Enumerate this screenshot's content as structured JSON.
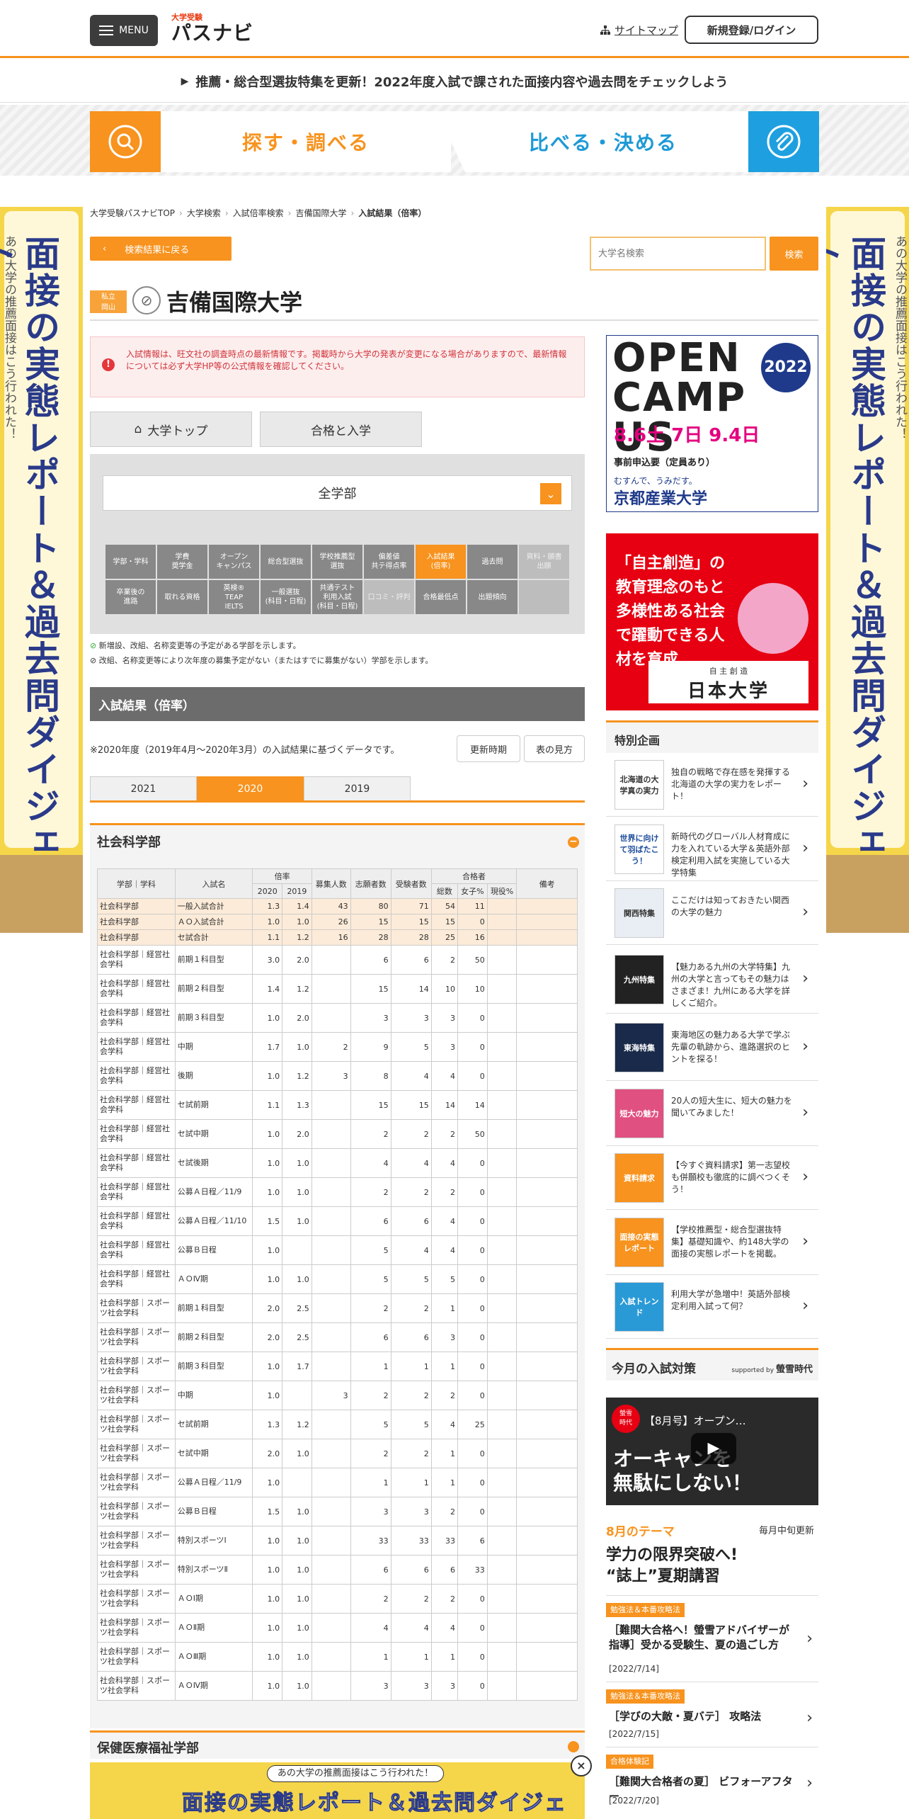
{
  "header": {
    "menu_label": "MENU",
    "logo_small": "大学受験",
    "logo_main": "パスナビ",
    "sitemap_label": "サイトマップ",
    "login_label": "新規登録/ログイン"
  },
  "notice": "推薦・総合型選抜特集を更新！2022年度入試で課された面接内容や過去問をチェックしよう",
  "main_tabs": {
    "search": "探す・調べる",
    "compare": "比べる・決める"
  },
  "side_banner": {
    "title": "面接の実態レポート＆過去問ダイジェスト",
    "sub": "あの大学の推薦面接はこう行われた！"
  },
  "breadcrumb": [
    "大学受験パスナビTOP",
    "大学検索",
    "入試倍率検索",
    "吉備国際大学",
    "入試結果（倍率）"
  ],
  "back_label": "検索結果に戻る",
  "search": {
    "placeholder": "大学名検索",
    "button": "検索"
  },
  "university": {
    "type": "私立",
    "pref": "岡山",
    "name": "吉備国際大学"
  },
  "alert": "入試情報は、旺文社の調査時点の最新情報です。掲載時から大学の発表が変更になる場合がありますので、最新情報については必ず大学HP等の公式情報を確認してください。",
  "buttons": {
    "top": "大学トップ",
    "pass": "合格と入学"
  },
  "faculty_select": "全学部",
  "nav_cells": [
    {
      "label": "学部・学科",
      "state": ""
    },
    {
      "label": "学費\n奨学金",
      "state": ""
    },
    {
      "label": "オープン\nキャンパス",
      "state": ""
    },
    {
      "label": "総合型選抜",
      "state": ""
    },
    {
      "label": "学校推薦型\n選抜",
      "state": ""
    },
    {
      "label": "偏差値\n共テ得点率",
      "state": ""
    },
    {
      "label": "入試結果\n(倍率)",
      "state": "on"
    },
    {
      "label": "過去問",
      "state": ""
    },
    {
      "label": "資料・願書\n出願",
      "state": "dis"
    },
    {
      "label": "卒業後の\n進路",
      "state": ""
    },
    {
      "label": "取れる資格",
      "state": ""
    },
    {
      "label": "英検®\nTEAP\nIELTS",
      "state": ""
    },
    {
      "label": "一般選抜\n(科目・日程)",
      "state": ""
    },
    {
      "label": "共通テスト\n利用入試\n(科目・日程)",
      "state": ""
    },
    {
      "label": "口コミ・評判",
      "state": "dis"
    },
    {
      "label": "合格最低点",
      "state": ""
    },
    {
      "label": "出題傾向",
      "state": ""
    },
    {
      "label": "",
      "state": "dis"
    }
  ],
  "legend": {
    "new": "新増設、改組、名称変更等の予定がある学部を示します。",
    "stop": "改組、名称変更等により次年度の募集予定がない（またはすでに募集がない）学部を示します。"
  },
  "section_title": "入試結果（倍率）",
  "note": "※2020年度（2019年4月～2020年3月）の入試結果に基づくデータです。",
  "period_label": "更新時期",
  "howto_label": "表の見方",
  "years": [
    "2021",
    "2020",
    "2019"
  ],
  "active_year": "2020",
  "faculty1": "社会科学部",
  "faculty2": "保健医療福祉学部",
  "table": {
    "headers": {
      "dept": "学部｜学科",
      "exam": "入試名",
      "ratio": "倍率",
      "y1": "2020",
      "y2": "2019",
      "quota": "募集人数",
      "applicants": "志願者数",
      "examinees": "受験者数",
      "passers": "合格者",
      "total": "総数",
      "female": "女子%",
      "current": "現役%",
      "remarks": "備考"
    },
    "rows": [
      {
        "d": "社会科学部",
        "e": "一般入試合計",
        "r1": "1.3",
        "r2": "1.4",
        "q": "43",
        "a": "80",
        "x": "71",
        "t": "54",
        "f": "11",
        "c": "",
        "hl": true
      },
      {
        "d": "社会科学部",
        "e": "ＡＯ入試合計",
        "r1": "1.0",
        "r2": "1.0",
        "q": "26",
        "a": "15",
        "x": "15",
        "t": "15",
        "f": "0",
        "c": "",
        "hl": true
      },
      {
        "d": "社会科学部",
        "e": "セ試合計",
        "r1": "1.1",
        "r2": "1.2",
        "q": "16",
        "a": "28",
        "x": "28",
        "t": "25",
        "f": "16",
        "c": "",
        "hl": true
      },
      {
        "d": "社会科学部｜経営社会学科",
        "e": "前期１科目型",
        "r1": "3.0",
        "r2": "2.0",
        "q": "",
        "a": "6",
        "x": "6",
        "t": "2",
        "f": "50",
        "c": ""
      },
      {
        "d": "社会科学部｜経営社会学科",
        "e": "前期２科目型",
        "r1": "1.4",
        "r2": "1.2",
        "q": "",
        "a": "15",
        "x": "14",
        "t": "10",
        "f": "10",
        "c": ""
      },
      {
        "d": "社会科学部｜経営社会学科",
        "e": "前期３科目型",
        "r1": "1.0",
        "r2": "2.0",
        "q": "",
        "a": "3",
        "x": "3",
        "t": "3",
        "f": "0",
        "c": ""
      },
      {
        "d": "社会科学部｜経営社会学科",
        "e": "中期",
        "r1": "1.7",
        "r2": "1.0",
        "q": "2",
        "a": "9",
        "x": "5",
        "t": "3",
        "f": "0",
        "c": ""
      },
      {
        "d": "社会科学部｜経営社会学科",
        "e": "後期",
        "r1": "1.0",
        "r2": "1.2",
        "q": "3",
        "a": "8",
        "x": "4",
        "t": "4",
        "f": "0",
        "c": ""
      },
      {
        "d": "社会科学部｜経営社会学科",
        "e": "セ試前期",
        "r1": "1.1",
        "r2": "1.3",
        "q": "",
        "a": "15",
        "x": "15",
        "t": "14",
        "f": "14",
        "c": ""
      },
      {
        "d": "社会科学部｜経営社会学科",
        "e": "セ試中期",
        "r1": "1.0",
        "r2": "2.0",
        "q": "",
        "a": "2",
        "x": "2",
        "t": "2",
        "f": "50",
        "c": ""
      },
      {
        "d": "社会科学部｜経営社会学科",
        "e": "セ試後期",
        "r1": "1.0",
        "r2": "1.0",
        "q": "",
        "a": "4",
        "x": "4",
        "t": "4",
        "f": "0",
        "c": ""
      },
      {
        "d": "社会科学部｜経営社会学科",
        "e": "公募Ａ日程／11/9",
        "r1": "1.0",
        "r2": "1.0",
        "q": "",
        "a": "2",
        "x": "2",
        "t": "2",
        "f": "0",
        "c": ""
      },
      {
        "d": "社会科学部｜経営社会学科",
        "e": "公募Ａ日程／11/10",
        "r1": "1.5",
        "r2": "1.0",
        "q": "",
        "a": "6",
        "x": "6",
        "t": "4",
        "f": "0",
        "c": ""
      },
      {
        "d": "社会科学部｜経営社会学科",
        "e": "公募Ｂ日程",
        "r1": "1.0",
        "r2": "",
        "q": "",
        "a": "5",
        "x": "4",
        "t": "4",
        "f": "0",
        "c": ""
      },
      {
        "d": "社会科学部｜経営社会学科",
        "e": "ＡＯⅣ期",
        "r1": "1.0",
        "r2": "1.0",
        "q": "",
        "a": "5",
        "x": "5",
        "t": "5",
        "f": "0",
        "c": ""
      },
      {
        "d": "社会科学部｜スポーツ社会学科",
        "e": "前期１科目型",
        "r1": "2.0",
        "r2": "2.5",
        "q": "",
        "a": "2",
        "x": "2",
        "t": "1",
        "f": "0",
        "c": ""
      },
      {
        "d": "社会科学部｜スポーツ社会学科",
        "e": "前期２科目型",
        "r1": "2.0",
        "r2": "2.5",
        "q": "",
        "a": "6",
        "x": "6",
        "t": "3",
        "f": "0",
        "c": ""
      },
      {
        "d": "社会科学部｜スポーツ社会学科",
        "e": "前期３科目型",
        "r1": "1.0",
        "r2": "1.7",
        "q": "",
        "a": "1",
        "x": "1",
        "t": "1",
        "f": "0",
        "c": ""
      },
      {
        "d": "社会科学部｜スポーツ社会学科",
        "e": "中期",
        "r1": "1.0",
        "r2": "",
        "q": "3",
        "a": "2",
        "x": "2",
        "t": "2",
        "f": "0",
        "c": ""
      },
      {
        "d": "社会科学部｜スポーツ社会学科",
        "e": "セ試前期",
        "r1": "1.3",
        "r2": "1.2",
        "q": "",
        "a": "5",
        "x": "5",
        "t": "4",
        "f": "25",
        "c": ""
      },
      {
        "d": "社会科学部｜スポーツ社会学科",
        "e": "セ試中期",
        "r1": "2.0",
        "r2": "1.0",
        "q": "",
        "a": "2",
        "x": "2",
        "t": "1",
        "f": "0",
        "c": ""
      },
      {
        "d": "社会科学部｜スポーツ社会学科",
        "e": "公募Ａ日程／11/9",
        "r1": "1.0",
        "r2": "",
        "q": "",
        "a": "1",
        "x": "1",
        "t": "1",
        "f": "0",
        "c": ""
      },
      {
        "d": "社会科学部｜スポーツ社会学科",
        "e": "公募Ｂ日程",
        "r1": "1.5",
        "r2": "1.0",
        "q": "",
        "a": "3",
        "x": "3",
        "t": "2",
        "f": "0",
        "c": ""
      },
      {
        "d": "社会科学部｜スポーツ社会学科",
        "e": "特別スポーツⅠ",
        "r1": "1.0",
        "r2": "1.0",
        "q": "",
        "a": "33",
        "x": "33",
        "t": "33",
        "f": "6",
        "c": ""
      },
      {
        "d": "社会科学部｜スポーツ社会学科",
        "e": "特別スポーツⅡ",
        "r1": "1.0",
        "r2": "1.0",
        "q": "",
        "a": "6",
        "x": "6",
        "t": "6",
        "f": "33",
        "c": ""
      },
      {
        "d": "社会科学部｜スポーツ社会学科",
        "e": "ＡＯⅠ期",
        "r1": "1.0",
        "r2": "1.0",
        "q": "",
        "a": "2",
        "x": "2",
        "t": "2",
        "f": "0",
        "c": ""
      },
      {
        "d": "社会科学部｜スポーツ社会学科",
        "e": "ＡＯⅡ期",
        "r1": "1.0",
        "r2": "1.0",
        "q": "",
        "a": "4",
        "x": "4",
        "t": "4",
        "f": "0",
        "c": ""
      },
      {
        "d": "社会科学部｜スポーツ社会学科",
        "e": "ＡＯⅢ期",
        "r1": "1.0",
        "r2": "1.0",
        "q": "",
        "a": "1",
        "x": "1",
        "t": "1",
        "f": "0",
        "c": ""
      },
      {
        "d": "社会科学部｜スポーツ社会学科",
        "e": "ＡＯⅣ期",
        "r1": "1.0",
        "r2": "1.0",
        "q": "",
        "a": "3",
        "x": "3",
        "t": "3",
        "f": "0",
        "c": ""
      }
    ]
  },
  "bottom_banner": {
    "sub": "あの大学の推薦面接はこう行われた！",
    "main": "面接の実態レポート＆過去問ダイジェスト"
  },
  "ad_open_campus": {
    "title": "OPEN CAMPUS",
    "year": "2022",
    "dates": "8.6土 7日 9.4日",
    "pre": "事前申込要（定員あり）",
    "tag": "むすんで、うみだす。",
    "univ": "京都産業大学"
  },
  "ad_nihon": {
    "text": "「自主創造」の教育理念のもと多様性ある社会で躍動できる人材を育成",
    "sub": "自 主 創 造",
    "univ": "日本大学"
  },
  "features_title": "特別企画",
  "features": [
    {
      "thumb": "北海道の大学真の実力",
      "text": "独自の戦略で存在感を発揮する北海道の大学の実力をレポート！"
    },
    {
      "thumb": "世界に向けて羽ばたこう！",
      "text": "新時代のグローバル人材育成に力を入れている大学＆英語外部検定利用入試を実施している大学特集"
    },
    {
      "thumb": "関西特集",
      "text": "ここだけは知っておきたい関西の大学の魅力"
    },
    {
      "thumb": "九州特集",
      "text": "【魅力ある九州の大学特集】九州の大学と言ってもその魅力はさまざま！九州にある大学を詳しくご紹介。"
    },
    {
      "thumb": "東海特集",
      "text": "東海地区の魅力ある大学で学ぶ先輩の軌跡から、進路選択のヒントを探る！"
    },
    {
      "thumb": "短大の魅力",
      "text": "20人の短大生に、短大の魅力を聞いてみました！"
    },
    {
      "thumb": "資料請求",
      "text": "【今すぐ資料請求】第一志望校も併願校も徹底的に調べつくそう！"
    },
    {
      "thumb": "面接の実態レポート",
      "text": "【学校推薦型・総合型選抜特集】基礎知識や、約148大学の面接の実態レポートを掲載。"
    },
    {
      "thumb": "入試トレンド",
      "text": "利用大学が急増中！英語外部検定利用入試って何？"
    }
  ],
  "today": {
    "title": "今月の入試対策",
    "supported": "supported by",
    "sponsor": "螢雪時代",
    "video_title": "【8月号】オープン…",
    "video_big": "オーキャンを\n無駄にしない！",
    "video_logo": "螢雪\n時代",
    "theme_label": "8月のテーマ",
    "update": "毎月中旬更新",
    "theme_title": "学力の限界突破へ!\n“誌上”夏期講習"
  },
  "articles": [
    {
      "tag": "勉強法＆本番攻略法",
      "title": "［難関大合格へ！螢雪アドバイザーが指導］受かる受験生、夏の過ごし方",
      "date": "[2022/7/14]"
    },
    {
      "tag": "勉強法＆本番攻略法",
      "title": "［学びの大敵・夏バテ］ 攻略法",
      "date": "[2022/7/15]"
    },
    {
      "tag": "合格体験記",
      "title": "［難関大合格者の夏］ ビフォーアフター",
      "date": "[2022/7/20]"
    }
  ]
}
